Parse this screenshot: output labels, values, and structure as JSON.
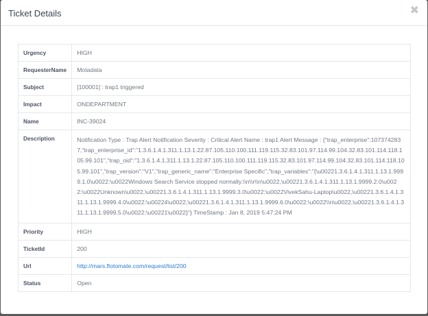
{
  "dialog": {
    "title": "Ticket Details",
    "close_icon": "close-icon"
  },
  "details": [
    {
      "label": "Urgency",
      "value": "HIGH"
    },
    {
      "label": "RequesterName",
      "value": "Motadata"
    },
    {
      "label": "Subject",
      "value": "[100001] : trap1 triggered"
    },
    {
      "label": "Impact",
      "value": "ONDEPARTMENT"
    },
    {
      "label": "Name",
      "value": "INC-39024"
    },
    {
      "label": "Description",
      "value": "Notification Type : Trap Alert Notification Severity : Critical Alert Name : trap1 Alert Message : {\"trap_enterprise\":1073742837,\"trap_enterprise_id\":\"1.3.6.1.4.1.311.1.13.1.22.87.105.110.100.111.119.115.32.83.101.97.114.99.104.32.83.101.114.118.105.99.101\",\"trap_oid\":\"1.3.6.1.4.1.311.1.13.1.22.87.105.110.100.111.119.115.32.83.101.97.114.99.104.32.83.101.114.118.105.99.101\",\"trap_version\":\"V1\",\"trap_generic_name\":\"Enterprise Specific\",\"trap_variables\":\"{\\u00221.3.6.1.4.1.311.1.13.1.9999.1.0\\u0022:\\u0022Windows Search Service stopped normally.\\\\n\\\\r\\\\n\\u0022,\\u00221.3.6.1.4.1.311.1.13.1.9999.2.0\\u0022:\\u0022Unknown\\u0022,\\u00221.3.6.1.4.1.311.1.13.1.9999.3.0\\u0022:\\u0022VivekSahu-Laptop\\u0022,\\u00221.3.6.1.4.1.311.1.13.1.9999.4.0\\u0022:\\u00224\\u0022,\\u00221.3.6.1.4.1.311.1.13.1.9999.6.0\\u0022:\\u0022\\\\n\\u0022,\\u00221.3.6.1.4.1.311.1.13.1.9999.5.0\\u0022:\\u00221\\u0022}\"} TimeStamp : Jan 8, 2019 5:47:24 PM"
    },
    {
      "label": "Priority",
      "value": "HIGH"
    },
    {
      "label": "TicketId",
      "value": "200"
    },
    {
      "label": "Url",
      "value": "http://mars.flotomate.com/request/list/200"
    },
    {
      "label": "Status",
      "value": "Open"
    }
  ],
  "colors": {
    "link": "#2a7bd3",
    "label": "#4a5367",
    "value": "#707784",
    "border": "#e4e7eb"
  }
}
